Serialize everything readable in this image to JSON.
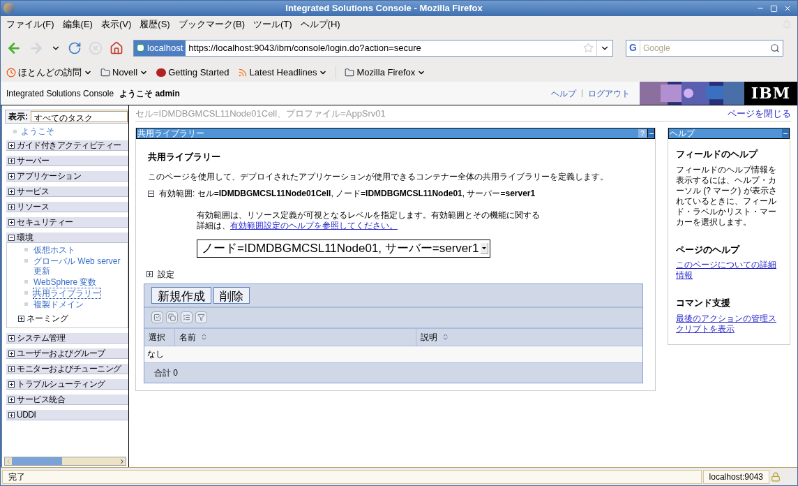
{
  "window": {
    "title": "Integrated Solutions Console - Mozilla Firefox"
  },
  "menu": [
    "ファイル(F)",
    "編集(E)",
    "表示(V)",
    "履歴(S)",
    "ブックマーク(B)",
    "ツール(T)",
    "ヘルプ(H)"
  ],
  "address": {
    "site": "localhost",
    "url": "https://localhost:9043/ibm/console/login.do?action=secure"
  },
  "search": {
    "engine": "G",
    "placeholder": "Google"
  },
  "bookmarks": [
    {
      "label": "ほとんどの訪問",
      "kind": "history",
      "dropdown": true
    },
    {
      "label": "Novell",
      "kind": "folder",
      "dropdown": true
    },
    {
      "label": "Getting Started",
      "kind": "site",
      "dropdown": false
    },
    {
      "label": "Latest Headlines",
      "kind": "feed",
      "dropdown": true
    },
    {
      "label": "Mozilla Firefox",
      "kind": "folder",
      "dropdown": true
    }
  ],
  "console": {
    "title": "Integrated Solutions Console",
    "welcome": "ようこそ admin",
    "links": [
      "ヘルプ",
      "ログアウト"
    ],
    "logo": "IBM"
  },
  "sidebar": {
    "view_label": "表示:",
    "view_value": "すべてのタスク",
    "welcome_link": "ようこそ",
    "groups": [
      {
        "label": "ガイド付きアクティビティー",
        "expanded": false
      },
      {
        "label": "サーバー",
        "expanded": false
      },
      {
        "label": "アプリケーション",
        "expanded": false
      },
      {
        "label": "サービス",
        "expanded": false
      },
      {
        "label": "リソース",
        "expanded": false
      },
      {
        "label": "セキュリティー",
        "expanded": false
      },
      {
        "label": "環境",
        "expanded": true,
        "children": [
          {
            "kind": "link",
            "label": "仮想ホスト",
            "selected": false
          },
          {
            "kind": "link",
            "label": "グローバル Web server 更新",
            "selected": false
          },
          {
            "kind": "link",
            "label": "WebSphere 変数",
            "selected": false
          },
          {
            "kind": "link",
            "label": "共用ライブラリー",
            "selected": true
          },
          {
            "kind": "link",
            "label": "複製ドメイン",
            "selected": false
          },
          {
            "kind": "group",
            "label": "ネーミング",
            "expanded": false
          }
        ]
      },
      {
        "label": "システム管理",
        "expanded": false
      },
      {
        "label": "ユーザーおよびグループ",
        "expanded": false
      },
      {
        "label": "モニターおよびチューニング",
        "expanded": false
      },
      {
        "label": "トラブルシューティング",
        "expanded": false
      },
      {
        "label": "サービス統合",
        "expanded": false
      },
      {
        "label": "UDDI",
        "expanded": false
      }
    ]
  },
  "breadcrumb": "セル=IDMDBGMCSL11Node01Cell、プロファイル=AppSrv01",
  "close_link": "ページを閉じる",
  "main": {
    "title": "共用ライブラリー",
    "heading": "共用ライブラリー",
    "description": "このページを使用して、デプロイされたアプリケーションが使用できるコンテナー全体の共用ライブラリーを定義します。",
    "scope": {
      "expanded": true,
      "text": "有効範囲: セル=**IDMDBGMCSL11Node01Cell**, ノード=**IDMDBGMCSL11Node01**, サーバー=**server1**",
      "help": "有効範囲は、リソース定義が可視となるレベルを指定します。有効範囲とその機能に関する詳細は、",
      "help_link": "有効範囲設定のヘルプを参照してください。",
      "select": "ノード=IDMDBGMCSL11Node01, サーバー=server1"
    },
    "settings": {
      "label": "設定",
      "expanded": false
    },
    "buttons": [
      "新規作成",
      "削除"
    ],
    "help_mark": "?",
    "columns": [
      {
        "label": "選択",
        "sortable": false
      },
      {
        "label": "名前",
        "sortable": true
      },
      {
        "label": "説明",
        "sortable": true
      }
    ],
    "empty": "なし",
    "total": "合計 0"
  },
  "help": {
    "title": "ヘルプ",
    "sections": [
      {
        "heading": "フィールドのヘルプ",
        "kind": "text",
        "text": "フィールドのヘルプ情報を表示するには、ヘルプ・カーソル (? マーク) が表示されているときに、フィールド・ラベルかリスト・マーカーを選択します。"
      },
      {
        "heading": "ページのヘルプ",
        "kind": "link",
        "text": "このページについての詳細情報"
      },
      {
        "heading": "コマンド支援",
        "kind": "link",
        "text": "最後のアクションの管理スクリプトを表示"
      }
    ]
  },
  "status": {
    "text": "完了",
    "host": "localhost:9043"
  }
}
